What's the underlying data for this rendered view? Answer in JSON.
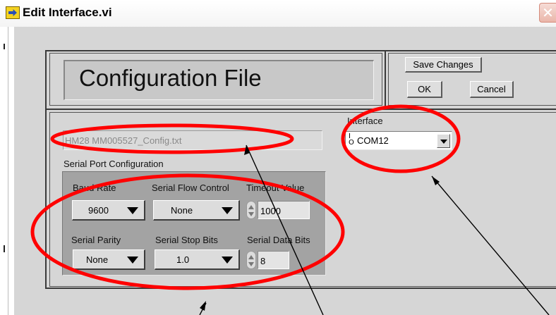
{
  "window": {
    "title": "Edit Interface.vi",
    "close_glyph": "✕",
    "icon": "labview-vi-icon"
  },
  "header": {
    "title": "Configuration File",
    "save_changes_label": "Save Changes",
    "ok_label": "OK",
    "cancel_label": "Cancel"
  },
  "config_file": {
    "path_value": "HM28 MM005527_Config.txt"
  },
  "serial_port": {
    "group_label": "Serial Port Configuration",
    "baud_rate": {
      "label": "Baud Rate",
      "value": "9600"
    },
    "flow_control": {
      "label": "Serial Flow Control",
      "value": "None"
    },
    "timeout": {
      "label": "Timeout Value",
      "value": "1000"
    },
    "parity": {
      "label": "Serial Parity",
      "value": "None"
    },
    "stop_bits": {
      "label": "Serial Stop Bits",
      "value": "1.0"
    },
    "data_bits": {
      "label": "Serial Data Bits",
      "value": "8"
    }
  },
  "interface": {
    "label": "Interface",
    "io_icon_top": "I",
    "io_icon_bottom": "O",
    "value": "COM12"
  },
  "colors": {
    "annotation": "#ff0000",
    "panel_background": "#d6d6d6",
    "cluster_background": "#a3a3a3"
  }
}
